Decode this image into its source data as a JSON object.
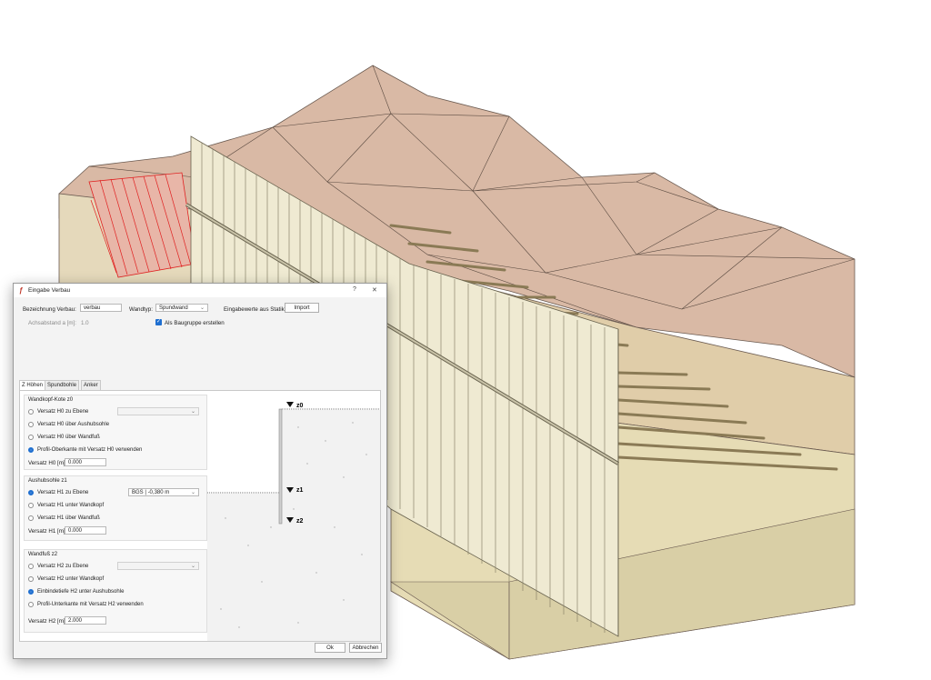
{
  "dialog": {
    "title": "Eingabe Verbau",
    "help": "?",
    "close": "✕",
    "app_icon": "app-logo-icon",
    "bezeichnung_label": "Bezeichnung Verbau:",
    "bezeichnung_value": "verbau",
    "wandtyp_label": "Wandtyp:",
    "wandtyp_value": "Spundwand",
    "statik_label": "Eingabewerte aus Statik:",
    "import_label": "Import",
    "achsabstand_label": "Achsabstand a [m]:",
    "achsabstand_value": "1.0",
    "baugruppe_label": "Als Baugruppe erstellen",
    "baugruppe_checked": true,
    "tabs": [
      {
        "label": "Z Höhen",
        "active": true
      },
      {
        "label": "Spundbohle",
        "active": false
      },
      {
        "label": "Anker",
        "active": false
      }
    ],
    "groups": {
      "wandkopf": {
        "title": "Wandkopf-Kote z0",
        "options": [
          {
            "label": "Versatz H0 zu Ebene",
            "checked": false
          },
          {
            "label": "Versatz H0 über Aushubsohle",
            "checked": false
          },
          {
            "label": "Versatz H0 über Wandfuß",
            "checked": false
          },
          {
            "label": "Profil-Oberkante mit Versatz H0 verwenden",
            "checked": true
          }
        ],
        "value_label": "Versatz H0 [m]:",
        "value": "0.000"
      },
      "aushubsohle": {
        "title": "Aushubsohle z1",
        "options": [
          {
            "label": "Versatz H1 zu Ebene",
            "checked": true
          },
          {
            "label": "Versatz H1 unter Wandkopf",
            "checked": false
          },
          {
            "label": "Versatz H1 über Wandfuß",
            "checked": false
          }
        ],
        "select_value": "BGS | -0,380 m",
        "value_label": "Versatz H1 [m]:",
        "value": "0.000"
      },
      "wandfuss": {
        "title": "Wandfuß z2",
        "options": [
          {
            "label": "Versatz H2 zu Ebene",
            "checked": false
          },
          {
            "label": "Versatz H2 unter Wandkopf",
            "checked": false
          },
          {
            "label": "Einbindetiefe H2 unter Aushubsohle",
            "checked": true
          },
          {
            "label": "Profil-Unterkante mit Versatz H2 verwenden",
            "checked": false
          }
        ],
        "value_label": "Versatz H2 [m]:",
        "value": "2.000"
      }
    },
    "preview": {
      "z0": "z0",
      "z1": "z1",
      "z2": "z2"
    },
    "ok_label": "Ok",
    "cancel_label": "Abbrechen"
  },
  "colors": {
    "terrain_top": "#d9b9a5",
    "terrain_side": "#e8dcc4",
    "soil_lower": "#e6dcb5",
    "sheet_pile": "#efead2",
    "accent": "#1f6fd0",
    "hatch_red": "#e02020"
  }
}
